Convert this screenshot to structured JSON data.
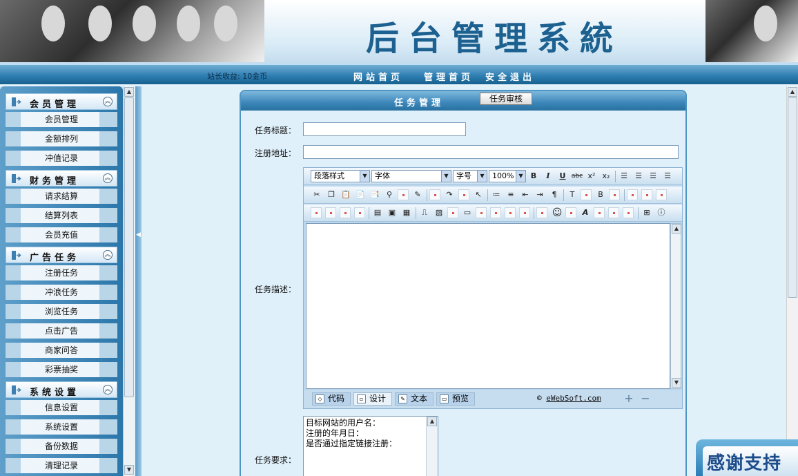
{
  "header": {
    "title": "后台管理系統",
    "earnings": "站长收益: 10金币",
    "nav": [
      {
        "label": "网站首页"
      },
      {
        "label": "管理首页"
      },
      {
        "label": "安全退出"
      }
    ]
  },
  "sidebar": {
    "groups": [
      {
        "title": "会员管理",
        "items": [
          "会员管理",
          "金额排列",
          "冲值记录"
        ]
      },
      {
        "title": "财务管理",
        "items": [
          "请求结算",
          "结算列表",
          "会员充值"
        ]
      },
      {
        "title": "广告任务",
        "items": [
          "注册任务",
          "冲浪任务",
          "浏览任务",
          "点击广告",
          "商家问答",
          "彩票抽奖"
        ]
      },
      {
        "title": "系统设置",
        "items": [
          "信息设置",
          "系统设置",
          "备份数据",
          "清理记录"
        ]
      }
    ]
  },
  "panel": {
    "title": "任务管理",
    "review_button": "任务审核",
    "labels": {
      "task_title": "任务标题：",
      "register_url": "注册地址：",
      "description": "任务描述：",
      "requirements": "任务要求："
    },
    "task_title_value": "",
    "register_url_value": "",
    "requirements_value": "目标网站的用户名：\n注册的年月日：\n是否通过指定链接注册："
  },
  "editor": {
    "paragraph_style": "段落样式",
    "font": "字体",
    "font_size": "字号",
    "zoom": "100%",
    "modes": [
      "代码",
      "设计",
      "文本",
      "预览"
    ],
    "active_mode": "设计",
    "credit_prefix": "©",
    "credit_link": "eWebSoft.com"
  },
  "thanks": "感谢支持",
  "colors": {
    "brand_blue": "#2f7fb3",
    "title_blue": "#1d6190",
    "panel_bg": "#dff0fa"
  }
}
